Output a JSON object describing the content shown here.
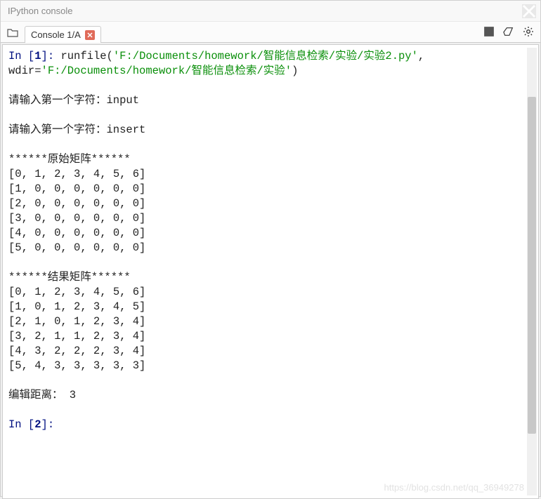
{
  "window": {
    "title": "IPython console"
  },
  "tab": {
    "label": "Console 1/A"
  },
  "console": {
    "in1_prefix": "In [",
    "in1_num": "1",
    "in1_suffix": "]: ",
    "runfile": "runfile(",
    "path1": "'F:/Documents/homework/智能信息检索/实验/实验2.py'",
    "comma_newline": ", ",
    "wdir_lbl": "wdir=",
    "path2": "'F:/Documents/homework/智能信息检索/实验'",
    "close_paren": ")",
    "prompt1": "请输入第一个字符：input",
    "prompt2": "请输入第一个字符：insert",
    "header1": "******原始矩阵******",
    "matrix1": [
      "[0, 1, 2, 3, 4, 5, 6]",
      "[1, 0, 0, 0, 0, 0, 0]",
      "[2, 0, 0, 0, 0, 0, 0]",
      "[3, 0, 0, 0, 0, 0, 0]",
      "[4, 0, 0, 0, 0, 0, 0]",
      "[5, 0, 0, 0, 0, 0, 0]"
    ],
    "header2": "******结果矩阵******",
    "matrix2": [
      "[0, 1, 2, 3, 4, 5, 6]",
      "[1, 0, 1, 2, 3, 4, 5]",
      "[2, 1, 0, 1, 2, 3, 4]",
      "[3, 2, 1, 1, 2, 3, 4]",
      "[4, 3, 2, 2, 2, 3, 4]",
      "[5, 4, 3, 3, 3, 3, 3]"
    ],
    "result": "编辑距离： 3",
    "in2_prefix": "In [",
    "in2_num": "2",
    "in2_suffix": "]: "
  },
  "watermark": "https://blog.csdn.net/qq_36949278"
}
